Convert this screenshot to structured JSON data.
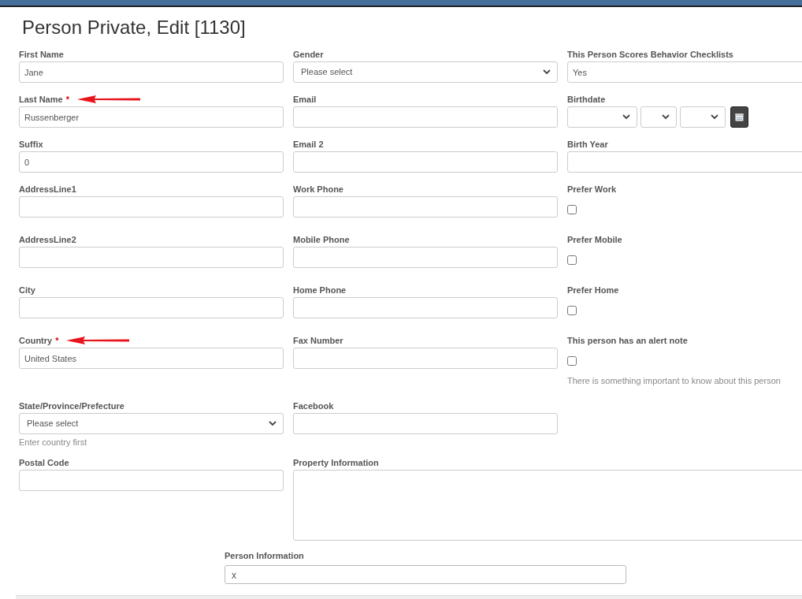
{
  "title": "Person Private, Edit [1130]",
  "rows": [
    [
      {
        "kind": "text",
        "label": "First Name",
        "value": "Jane"
      },
      {
        "kind": "select",
        "label": "Gender",
        "value": "Please select"
      },
      {
        "kind": "text",
        "label": "This Person Scores Behavior Checklists",
        "value": "Yes"
      }
    ],
    [
      {
        "kind": "text",
        "label": "Last Name",
        "required_mark": "*",
        "arrow": true,
        "value": "Russenberger"
      },
      {
        "kind": "text",
        "label": "Email"
      },
      {
        "kind": "date",
        "label": "Birthdate"
      }
    ],
    [
      {
        "kind": "text",
        "label": "Suffix",
        "value": "0"
      },
      {
        "kind": "text",
        "label": "Email 2"
      },
      {
        "kind": "text",
        "label": "Birth Year"
      }
    ],
    [
      {
        "kind": "text",
        "label": "AddressLine1"
      },
      {
        "kind": "text",
        "label": "Work Phone"
      },
      {
        "kind": "checkbox",
        "label": "Prefer Work",
        "checked": false
      }
    ],
    [
      {
        "kind": "text",
        "label": "AddressLine2"
      },
      {
        "kind": "text",
        "label": "Mobile Phone"
      },
      {
        "kind": "checkbox",
        "label": "Prefer Mobile",
        "checked": false
      }
    ],
    [
      {
        "kind": "text",
        "label": "City"
      },
      {
        "kind": "text",
        "label": "Home Phone"
      },
      {
        "kind": "checkbox",
        "label": "Prefer Home",
        "checked": false
      }
    ],
    [
      {
        "kind": "text",
        "label": "Country",
        "required_mark": "*",
        "arrow": true,
        "value": "United States"
      },
      {
        "kind": "text",
        "label": "Fax Number"
      },
      {
        "kind": "checkbox",
        "label": "This person has an alert note",
        "checked": false,
        "help": "There is something important to know about this person"
      }
    ],
    [
      {
        "kind": "select",
        "label": "State/Province/Prefecture",
        "value": "Please select",
        "help": "Enter country first"
      },
      {
        "kind": "text",
        "label": "Facebook"
      }
    ],
    [
      {
        "kind": "text",
        "label": "Postal Code"
      },
      {
        "kind": "textarea",
        "label": "Property Information",
        "wide": true
      }
    ]
  ],
  "person_information": {
    "label": "Person Information",
    "value": "x"
  }
}
